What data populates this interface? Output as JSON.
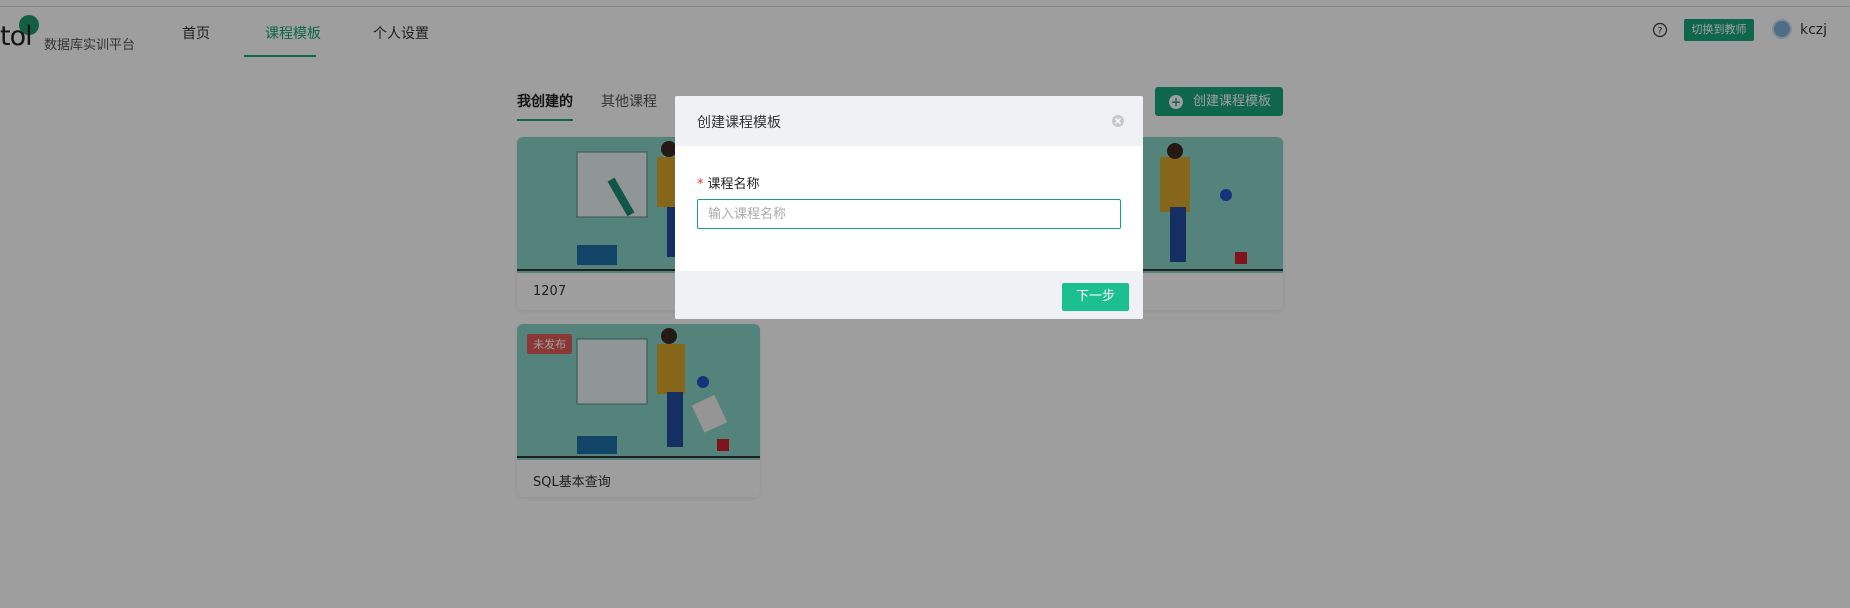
{
  "header": {
    "logo_mark": "tol",
    "platform_name": "数据库实训平台",
    "nav": [
      {
        "label": "首页",
        "active": false
      },
      {
        "label": "课程模板",
        "active": true
      },
      {
        "label": "个人设置",
        "active": false
      }
    ],
    "switch_label": "切换到教师",
    "username": "kczj",
    "help_icon": "question-circle-icon",
    "avatar_icon": "user-avatar-icon"
  },
  "main": {
    "tabs": [
      {
        "label": "我创建的",
        "active": true
      },
      {
        "label": "其他课程",
        "active": false
      }
    ],
    "create_button_label": "创建课程模板",
    "create_icon": "plus-circle-icon",
    "cards": [
      {
        "title": "1207",
        "badge": ""
      },
      {
        "title": "",
        "badge": ""
      },
      {
        "title": "SQL基本查询",
        "badge": "未发布"
      }
    ]
  },
  "modal": {
    "title": "创建课程模板",
    "close_icon": "close-circle-icon",
    "required_mark": "*",
    "field_label": "课程名称",
    "input_value": "",
    "input_placeholder": "输入课程名称",
    "next_label": "下一步"
  },
  "colors": {
    "accent": "#16a57a",
    "button_green": "#1cc08f",
    "badge_red": "#e05a5a",
    "card_bg": "#86d3c7"
  }
}
